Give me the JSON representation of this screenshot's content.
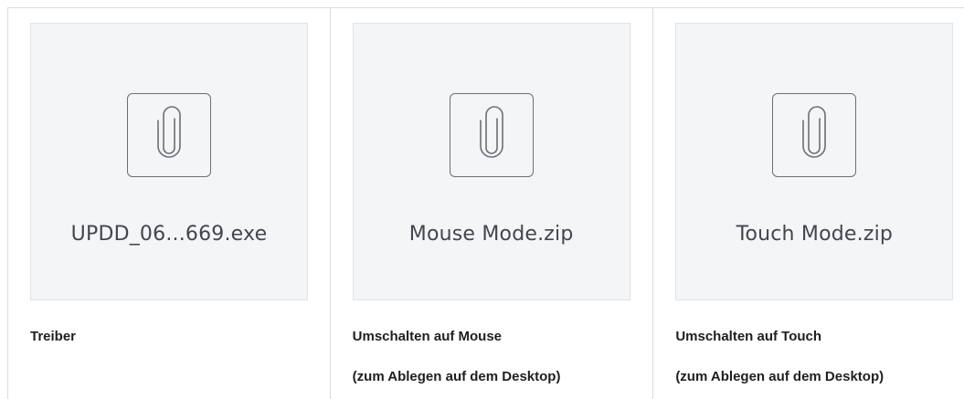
{
  "attachments": [
    {
      "filename": "UPDD_06...669.exe",
      "icon": "paperclip-icon",
      "caption_lines": [
        "Treiber"
      ]
    },
    {
      "filename": "Mouse Mode.zip",
      "icon": "paperclip-icon",
      "caption_lines": [
        "Umschalten auf Mouse",
        "(zum Ablegen auf dem Desktop)"
      ]
    },
    {
      "filename": "Touch Mode.zip",
      "icon": "paperclip-icon",
      "caption_lines": [
        "Umschalten auf Touch",
        "(zum Ablegen auf dem Desktop)"
      ]
    }
  ],
  "colors": {
    "thumb_bg": "#f4f5f7",
    "border": "#d8dce3",
    "icon_stroke": "#6b6f76",
    "filename_text": "#42464d",
    "caption_text": "#1f1f1f"
  }
}
